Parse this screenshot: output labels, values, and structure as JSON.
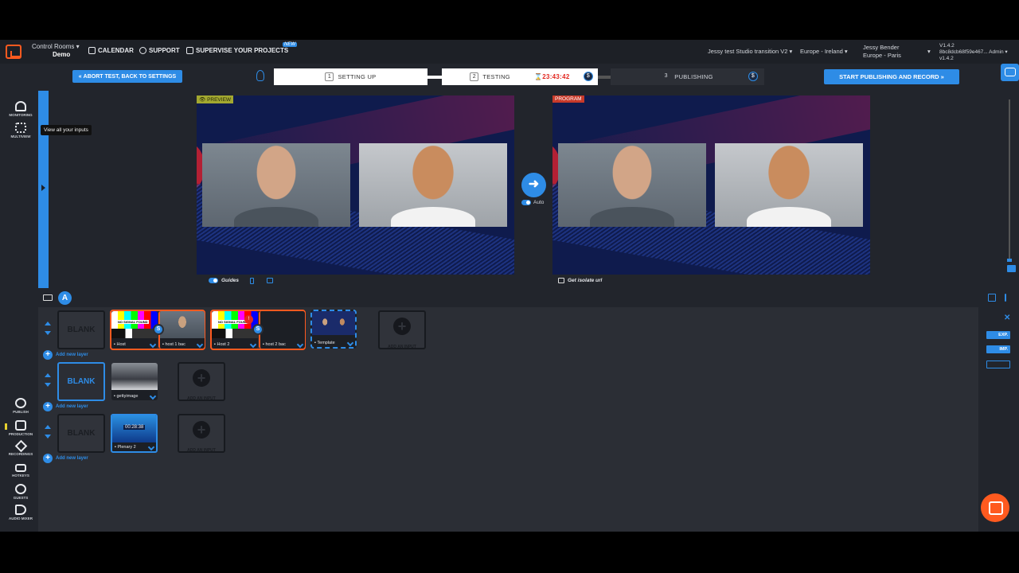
{
  "header": {
    "app_name": "Control Rooms",
    "workspace": "Demo",
    "nav": {
      "calendar": "CALENDAR",
      "support": "SUPPORT",
      "supervise": "SUPERVISE YOUR PROJECTS",
      "new_badge": "NEW"
    },
    "project": "Jessy test Studio transition V2",
    "region": "Europe - Ireland",
    "user_name": "Jessy Bender",
    "user_tz": "Europe - Paris",
    "version": "V1.4.2",
    "session_id": "8bc8dcb68f59e467...",
    "version2": "v1.4.2",
    "role": "Admin"
  },
  "steps": {
    "abort": "ABORT TEST, BACK TO SETTINGS",
    "step1_num": "1",
    "step1": "SETTING UP",
    "step2_num": "2",
    "step2": "TESTING",
    "timer": "23:43:42",
    "step3_num": "3",
    "step3": "PUBLISHING",
    "start": "START PUBLISHING AND RECORD",
    "dollar": "$"
  },
  "sidebar": {
    "monitoring": "MONITORING",
    "multiview": "MULTIVIEW",
    "tooltip": "View all your inputs",
    "publish": "PUBLISH",
    "production": "PRODUCTION",
    "recordings": "RECORDINGS",
    "hotkeys": "HOTKEYS",
    "guests": "GUESTS",
    "audio_mixer": "AUDIO MIXER"
  },
  "monitors": {
    "preview_tag": "PREVIEW",
    "program_tag": "PROGRAM",
    "auto": "Auto",
    "guides": "Guides",
    "isolate": "Get isolate url"
  },
  "scene": {
    "layer_badge": "A",
    "blank": "BLANK",
    "add_layer": "Add new layer",
    "add_input": "ADD AN INPUT",
    "no_signal": "NO SIGNAL FOUND",
    "cards": {
      "host": "Host",
      "host1_bac": "host 1 bac",
      "host2": "Host 2",
      "host2_bac": "host 2 bac",
      "template": "Template",
      "gettyimage": "gettyimage",
      "plenary": "Plenary 2",
      "plenary_time": "00:28:38"
    },
    "badge_s": "S",
    "red_badge": "!"
  },
  "right_panel": {
    "exp": "EXP.",
    "imp": "IMP."
  },
  "colors": {
    "accent": "#2e8ce6",
    "brand": "#ff5a1f",
    "bg": "#22252c",
    "timer_red": "#e2261e"
  }
}
